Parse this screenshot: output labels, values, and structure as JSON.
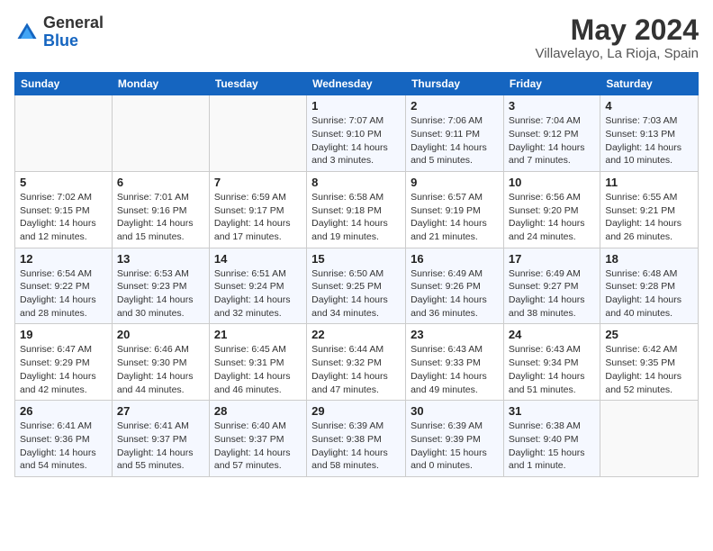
{
  "header": {
    "logo_general": "General",
    "logo_blue": "Blue",
    "month_title": "May 2024",
    "location": "Villavelayo, La Rioja, Spain"
  },
  "weekdays": [
    "Sunday",
    "Monday",
    "Tuesday",
    "Wednesday",
    "Thursday",
    "Friday",
    "Saturday"
  ],
  "weeks": [
    [
      {
        "day": "",
        "sunrise": "",
        "sunset": "",
        "daylight": ""
      },
      {
        "day": "",
        "sunrise": "",
        "sunset": "",
        "daylight": ""
      },
      {
        "day": "",
        "sunrise": "",
        "sunset": "",
        "daylight": ""
      },
      {
        "day": "1",
        "sunrise": "Sunrise: 7:07 AM",
        "sunset": "Sunset: 9:10 PM",
        "daylight": "Daylight: 14 hours and 3 minutes."
      },
      {
        "day": "2",
        "sunrise": "Sunrise: 7:06 AM",
        "sunset": "Sunset: 9:11 PM",
        "daylight": "Daylight: 14 hours and 5 minutes."
      },
      {
        "day": "3",
        "sunrise": "Sunrise: 7:04 AM",
        "sunset": "Sunset: 9:12 PM",
        "daylight": "Daylight: 14 hours and 7 minutes."
      },
      {
        "day": "4",
        "sunrise": "Sunrise: 7:03 AM",
        "sunset": "Sunset: 9:13 PM",
        "daylight": "Daylight: 14 hours and 10 minutes."
      }
    ],
    [
      {
        "day": "5",
        "sunrise": "Sunrise: 7:02 AM",
        "sunset": "Sunset: 9:15 PM",
        "daylight": "Daylight: 14 hours and 12 minutes."
      },
      {
        "day": "6",
        "sunrise": "Sunrise: 7:01 AM",
        "sunset": "Sunset: 9:16 PM",
        "daylight": "Daylight: 14 hours and 15 minutes."
      },
      {
        "day": "7",
        "sunrise": "Sunrise: 6:59 AM",
        "sunset": "Sunset: 9:17 PM",
        "daylight": "Daylight: 14 hours and 17 minutes."
      },
      {
        "day": "8",
        "sunrise": "Sunrise: 6:58 AM",
        "sunset": "Sunset: 9:18 PM",
        "daylight": "Daylight: 14 hours and 19 minutes."
      },
      {
        "day": "9",
        "sunrise": "Sunrise: 6:57 AM",
        "sunset": "Sunset: 9:19 PM",
        "daylight": "Daylight: 14 hours and 21 minutes."
      },
      {
        "day": "10",
        "sunrise": "Sunrise: 6:56 AM",
        "sunset": "Sunset: 9:20 PM",
        "daylight": "Daylight: 14 hours and 24 minutes."
      },
      {
        "day": "11",
        "sunrise": "Sunrise: 6:55 AM",
        "sunset": "Sunset: 9:21 PM",
        "daylight": "Daylight: 14 hours and 26 minutes."
      }
    ],
    [
      {
        "day": "12",
        "sunrise": "Sunrise: 6:54 AM",
        "sunset": "Sunset: 9:22 PM",
        "daylight": "Daylight: 14 hours and 28 minutes."
      },
      {
        "day": "13",
        "sunrise": "Sunrise: 6:53 AM",
        "sunset": "Sunset: 9:23 PM",
        "daylight": "Daylight: 14 hours and 30 minutes."
      },
      {
        "day": "14",
        "sunrise": "Sunrise: 6:51 AM",
        "sunset": "Sunset: 9:24 PM",
        "daylight": "Daylight: 14 hours and 32 minutes."
      },
      {
        "day": "15",
        "sunrise": "Sunrise: 6:50 AM",
        "sunset": "Sunset: 9:25 PM",
        "daylight": "Daylight: 14 hours and 34 minutes."
      },
      {
        "day": "16",
        "sunrise": "Sunrise: 6:49 AM",
        "sunset": "Sunset: 9:26 PM",
        "daylight": "Daylight: 14 hours and 36 minutes."
      },
      {
        "day": "17",
        "sunrise": "Sunrise: 6:49 AM",
        "sunset": "Sunset: 9:27 PM",
        "daylight": "Daylight: 14 hours and 38 minutes."
      },
      {
        "day": "18",
        "sunrise": "Sunrise: 6:48 AM",
        "sunset": "Sunset: 9:28 PM",
        "daylight": "Daylight: 14 hours and 40 minutes."
      }
    ],
    [
      {
        "day": "19",
        "sunrise": "Sunrise: 6:47 AM",
        "sunset": "Sunset: 9:29 PM",
        "daylight": "Daylight: 14 hours and 42 minutes."
      },
      {
        "day": "20",
        "sunrise": "Sunrise: 6:46 AM",
        "sunset": "Sunset: 9:30 PM",
        "daylight": "Daylight: 14 hours and 44 minutes."
      },
      {
        "day": "21",
        "sunrise": "Sunrise: 6:45 AM",
        "sunset": "Sunset: 9:31 PM",
        "daylight": "Daylight: 14 hours and 46 minutes."
      },
      {
        "day": "22",
        "sunrise": "Sunrise: 6:44 AM",
        "sunset": "Sunset: 9:32 PM",
        "daylight": "Daylight: 14 hours and 47 minutes."
      },
      {
        "day": "23",
        "sunrise": "Sunrise: 6:43 AM",
        "sunset": "Sunset: 9:33 PM",
        "daylight": "Daylight: 14 hours and 49 minutes."
      },
      {
        "day": "24",
        "sunrise": "Sunrise: 6:43 AM",
        "sunset": "Sunset: 9:34 PM",
        "daylight": "Daylight: 14 hours and 51 minutes."
      },
      {
        "day": "25",
        "sunrise": "Sunrise: 6:42 AM",
        "sunset": "Sunset: 9:35 PM",
        "daylight": "Daylight: 14 hours and 52 minutes."
      }
    ],
    [
      {
        "day": "26",
        "sunrise": "Sunrise: 6:41 AM",
        "sunset": "Sunset: 9:36 PM",
        "daylight": "Daylight: 14 hours and 54 minutes."
      },
      {
        "day": "27",
        "sunrise": "Sunrise: 6:41 AM",
        "sunset": "Sunset: 9:37 PM",
        "daylight": "Daylight: 14 hours and 55 minutes."
      },
      {
        "day": "28",
        "sunrise": "Sunrise: 6:40 AM",
        "sunset": "Sunset: 9:37 PM",
        "daylight": "Daylight: 14 hours and 57 minutes."
      },
      {
        "day": "29",
        "sunrise": "Sunrise: 6:39 AM",
        "sunset": "Sunset: 9:38 PM",
        "daylight": "Daylight: 14 hours and 58 minutes."
      },
      {
        "day": "30",
        "sunrise": "Sunrise: 6:39 AM",
        "sunset": "Sunset: 9:39 PM",
        "daylight": "Daylight: 15 hours and 0 minutes."
      },
      {
        "day": "31",
        "sunrise": "Sunrise: 6:38 AM",
        "sunset": "Sunset: 9:40 PM",
        "daylight": "Daylight: 15 hours and 1 minute."
      },
      {
        "day": "",
        "sunrise": "",
        "sunset": "",
        "daylight": ""
      }
    ]
  ]
}
